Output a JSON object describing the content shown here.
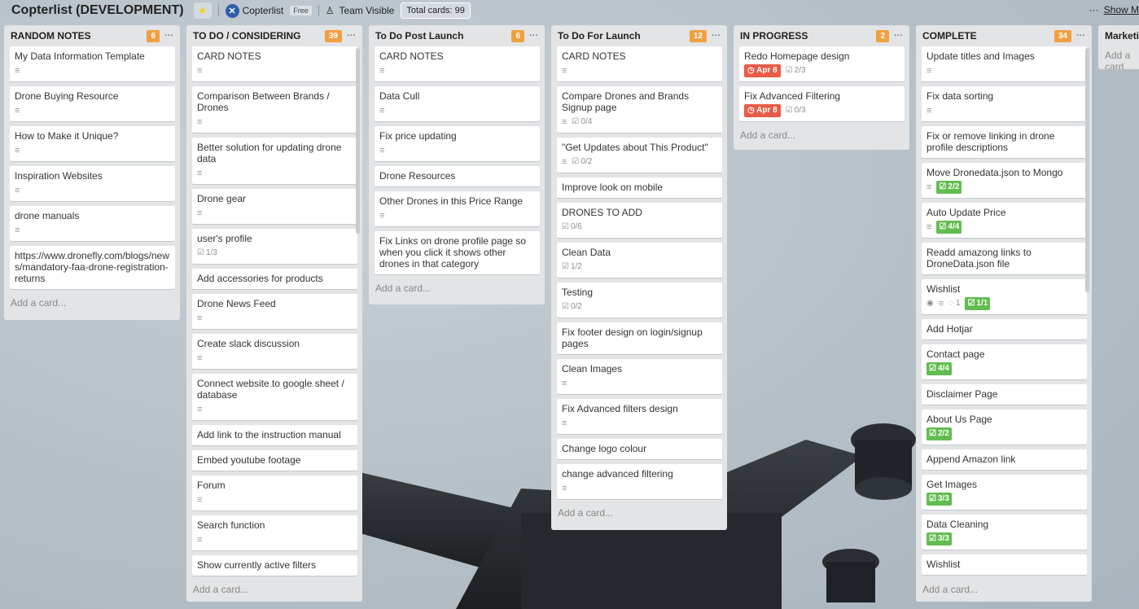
{
  "header": {
    "board_title": "Copterlist (DEVELOPMENT)",
    "team_name": "Copterlist",
    "team_plan": "Free",
    "visibility": "Team Visible",
    "total_cards": "Total cards: 99",
    "show_menu": "Show M"
  },
  "add_card_label": "Add a card...",
  "lists": [
    {
      "name": "RANDOM NOTES",
      "count": "6",
      "cards": [
        {
          "title": "My Data Information Template",
          "desc": true
        },
        {
          "title": "Drone Buying Resource",
          "desc": true
        },
        {
          "title": "How to Make it Unique?",
          "desc": true
        },
        {
          "title": "Inspiration Websites",
          "desc": true
        },
        {
          "title": "drone manuals",
          "desc": true
        },
        {
          "title": "https://www.dronefly.com/blogs/news/mandatory-faa-drone-registration-returns",
          "desc": false
        }
      ]
    },
    {
      "name": "TO DO / CONSIDERING",
      "count": "39",
      "cards": [
        {
          "title": "CARD NOTES",
          "desc": true
        },
        {
          "title": "Comparison Between Brands / Drones",
          "desc": true
        },
        {
          "title": "Better solution for updating drone data",
          "desc": true
        },
        {
          "title": "Drone gear",
          "desc": true
        },
        {
          "title": "user's profile",
          "desc": false,
          "check": "1/3"
        },
        {
          "title": "Add accessories for products",
          "desc": false
        },
        {
          "title": "Drone News Feed",
          "desc": true
        },
        {
          "title": "Create slack discussion",
          "desc": true
        },
        {
          "title": "Connect website to google sheet / database",
          "desc": true
        },
        {
          "title": "Add link to the instruction manual",
          "desc": false
        },
        {
          "title": "Embed youtube footage",
          "desc": false
        },
        {
          "title": "Forum",
          "desc": true
        },
        {
          "title": "Search function",
          "desc": true
        },
        {
          "title": "Show currently active filters",
          "desc": false
        }
      ]
    },
    {
      "name": "To Do Post Launch",
      "count": "6",
      "cards": [
        {
          "title": "CARD NOTES",
          "desc": true
        },
        {
          "title": "Data Cull",
          "desc": true
        },
        {
          "title": "Fix price updating",
          "desc": true
        },
        {
          "title": "Drone Resources",
          "desc": false
        },
        {
          "title": "Other Drones in this Price Range",
          "desc": true
        },
        {
          "title": "Fix Links on drone profile page so when you click it shows other drones in that category",
          "desc": false
        }
      ]
    },
    {
      "name": "To Do For Launch",
      "count": "12",
      "cards": [
        {
          "title": "CARD NOTES",
          "desc": true
        },
        {
          "title": "Compare Drones and Brands Signup page",
          "desc": true,
          "check": "0/4"
        },
        {
          "title": "\"Get Updates about This Product\"",
          "desc": true,
          "check": "0/2"
        },
        {
          "title": "Improve look on mobile",
          "desc": false
        },
        {
          "title": "DRONES TO ADD",
          "desc": false,
          "check": "0/6"
        },
        {
          "title": "Clean Data",
          "desc": false,
          "check": "1/2"
        },
        {
          "title": "Testing",
          "desc": false,
          "check": "0/2"
        },
        {
          "title": "Fix footer design on login/signup pages",
          "desc": false
        },
        {
          "title": "Clean Images",
          "desc": true
        },
        {
          "title": "Fix Advanced filters design",
          "desc": true
        },
        {
          "title": "Change logo colour",
          "desc": false
        },
        {
          "title": "change advanced filtering",
          "desc": true
        }
      ]
    },
    {
      "name": "IN PROGRESS",
      "count": "2",
      "cards": [
        {
          "title": "Redo Homepage design",
          "desc": false,
          "due": "Apr 8",
          "check": "2/3"
        },
        {
          "title": "Fix Advanced Filtering",
          "desc": false,
          "due": "Apr 8",
          "check": "0/3"
        }
      ]
    },
    {
      "name": "COMPLETE",
      "count": "34",
      "cards": [
        {
          "title": "Update titles and Images",
          "desc": true
        },
        {
          "title": "Fix data sorting",
          "desc": true
        },
        {
          "title": "Fix or remove linking in drone profile descriptions",
          "desc": false
        },
        {
          "title": "Move Dronedata.json to Mongo",
          "desc": true,
          "check_done": "2/2"
        },
        {
          "title": "Auto Update Price",
          "desc": true,
          "check_done": "4/4"
        },
        {
          "title": "Readd amazong links to DroneData.json file",
          "desc": false
        },
        {
          "title": "Wishlist",
          "desc": true,
          "watch": true,
          "comments": "1",
          "check_done": "1/1"
        },
        {
          "title": "Add Hotjar",
          "desc": false
        },
        {
          "title": "Contact page",
          "desc": false,
          "check_done": "4/4"
        },
        {
          "title": "Disclaimer Page",
          "desc": false
        },
        {
          "title": "About Us Page",
          "desc": false,
          "check_done": "2/2"
        },
        {
          "title": "Append Amazon link",
          "desc": false
        },
        {
          "title": "Get Images",
          "desc": false,
          "check_done": "3/3"
        },
        {
          "title": "Data Cleaning",
          "desc": false,
          "check_done": "3/3"
        },
        {
          "title": "Wishlist",
          "desc": false
        }
      ]
    },
    {
      "name": "Marketing",
      "count": "",
      "cards": []
    }
  ]
}
